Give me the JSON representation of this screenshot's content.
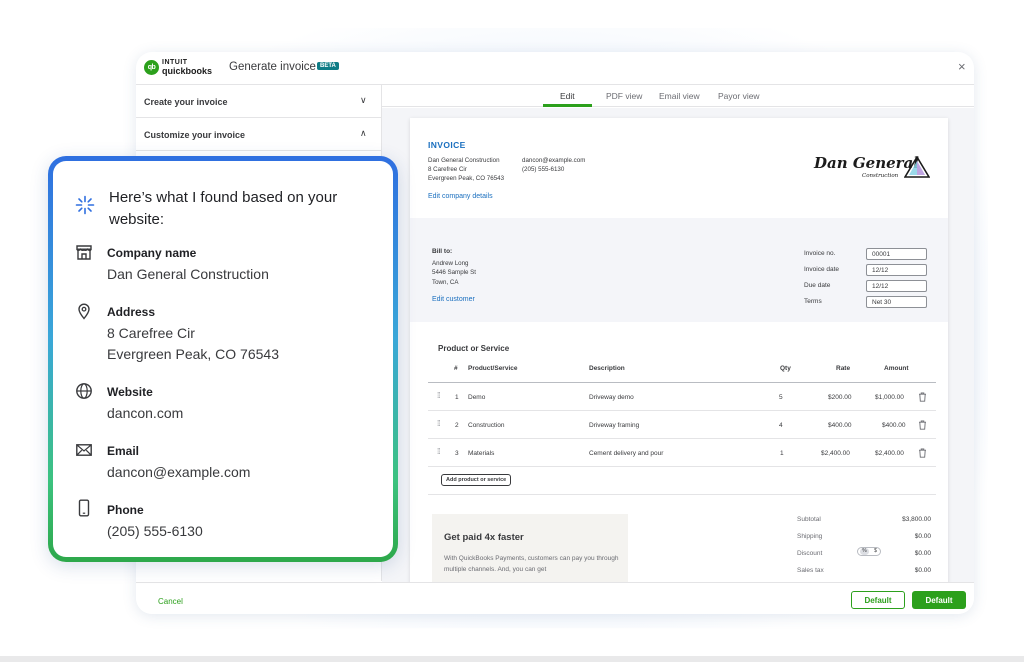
{
  "app": {
    "logo_mark": "qb",
    "logo_intuit": "INTUIT",
    "logo_product": "quickbooks",
    "title": "Generate invoice",
    "badge": "BETA",
    "close_icon": "×"
  },
  "sidebar": {
    "sections": [
      {
        "label": "Create your invoice",
        "state": "collapsed",
        "chevron": "∨"
      },
      {
        "label": "Customize your invoice",
        "state": "expanded",
        "chevron": "∧"
      }
    ]
  },
  "tabs": [
    {
      "label": "Edit",
      "active": true
    },
    {
      "label": "PDF view",
      "active": false
    },
    {
      "label": "Email view",
      "active": false
    },
    {
      "label": "Payor view",
      "active": false
    }
  ],
  "invoice": {
    "heading": "INVOICE",
    "company": {
      "name": "Dan General Construction",
      "address_line1": "8 Carefree Cir",
      "address_line2": "Evergreen Peak, CO 76543",
      "email": "dancon@example.com",
      "phone": "(205) 555-6130",
      "edit_link": "Edit company details"
    },
    "logo": {
      "name": "Dan General",
      "sub": "Construction"
    },
    "bill_to": {
      "label": "Bill to:",
      "name": "Andrew Long",
      "street": "5446 Sample St",
      "town": "Town, CA",
      "edit_link": "Edit customer"
    },
    "meta": [
      {
        "label": "Invoice no.",
        "value": "00001"
      },
      {
        "label": "Invoice date",
        "value": "12/12"
      },
      {
        "label": "Due date",
        "value": "12/12"
      },
      {
        "label": "Terms",
        "value": "Net 30"
      }
    ],
    "products_heading": "Product or Service",
    "columns": [
      "#",
      "Product/Service",
      "Description",
      "Qty",
      "Rate",
      "Amount"
    ],
    "line_items": [
      {
        "num": "1",
        "product": "Demo",
        "description": "Driveway demo",
        "qty": "5",
        "rate": "$200.00",
        "amount": "$1,000.00"
      },
      {
        "num": "2",
        "product": "Construction",
        "description": "Driveway framing",
        "qty": "4",
        "rate": "$400.00",
        "amount": "$400.00"
      },
      {
        "num": "3",
        "product": "Materials",
        "description": "Cement delivery and pour",
        "qty": "1",
        "rate": "$2,400.00",
        "amount": "$2,400.00"
      }
    ],
    "add_button": "Add product or service",
    "promo": {
      "title": "Get paid 4x faster",
      "text": "With QuickBooks Payments, customers can pay you through multiple channels. And, you can get"
    },
    "totals": [
      {
        "label": "Subtotal",
        "value": "$3,800.00"
      },
      {
        "label": "Shipping",
        "value": "$0.00"
      },
      {
        "label": "Discount",
        "value": "$0.00"
      },
      {
        "label": "Sales tax",
        "value": "$0.00"
      }
    ],
    "discount_toggle": {
      "percent": "%",
      "dollar": "$"
    }
  },
  "footer": {
    "cancel": "Cancel",
    "secondary_button": "Default",
    "primary_button": "Default"
  },
  "found_card": {
    "heading": "Here’s what I found based on your website:",
    "fields": [
      {
        "label": "Company name",
        "value": "Dan General Construction",
        "icon": "storefront-icon"
      },
      {
        "label": "Address",
        "value": "8 Carefree Cir",
        "value2": "Evergreen Peak, CO 76543",
        "icon": "location-pin-icon"
      },
      {
        "label": "Website",
        "value": "dancon.com",
        "icon": "globe-icon"
      },
      {
        "label": "Email",
        "value": "dancon@example.com",
        "icon": "envelope-icon"
      },
      {
        "label": "Phone",
        "value": "(205) 555-6130",
        "icon": "phone-icon"
      }
    ]
  },
  "colors": {
    "brand_green": "#2ca01c",
    "link_blue": "#1a6fbf",
    "gradient_start": "#2f6fe0",
    "gradient_end": "#2da84a",
    "text": "#393a3d"
  }
}
